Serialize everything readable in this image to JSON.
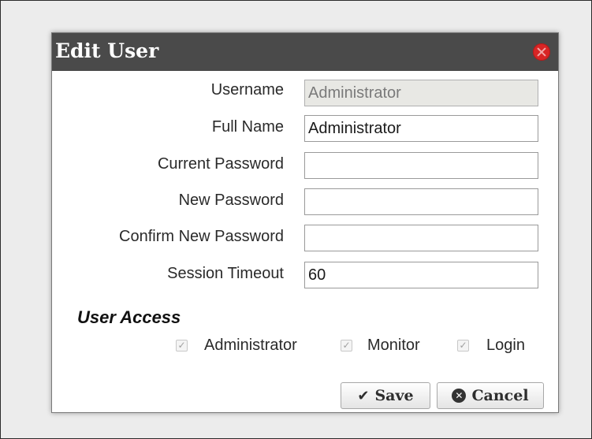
{
  "dialog": {
    "title": "Edit User",
    "close_icon": "close-circle-icon"
  },
  "form": {
    "username": {
      "label": "Username",
      "value": "Administrator",
      "readonly": true
    },
    "full_name": {
      "label": "Full Name",
      "value": "Administrator"
    },
    "current_password": {
      "label": "Current Password",
      "value": ""
    },
    "new_password": {
      "label": "New Password",
      "value": ""
    },
    "confirm_password": {
      "label": "Confirm New Password",
      "value": ""
    },
    "session_timeout": {
      "label": "Session Timeout",
      "value": "60"
    }
  },
  "user_access": {
    "title": "User Access",
    "options": [
      {
        "label": "Administrator",
        "checked": true,
        "disabled": true
      },
      {
        "label": "Monitor",
        "checked": true,
        "disabled": true
      },
      {
        "label": "Login",
        "checked": true,
        "disabled": true
      }
    ]
  },
  "buttons": {
    "save_label": "Save",
    "save_icon": "checkmark-icon",
    "cancel_label": "Cancel",
    "cancel_icon": "close-circle-icon"
  },
  "colors": {
    "titlebar": "#4a4a4a",
    "close_button": "#d82525",
    "readonly_field": "#e8e8e4"
  }
}
